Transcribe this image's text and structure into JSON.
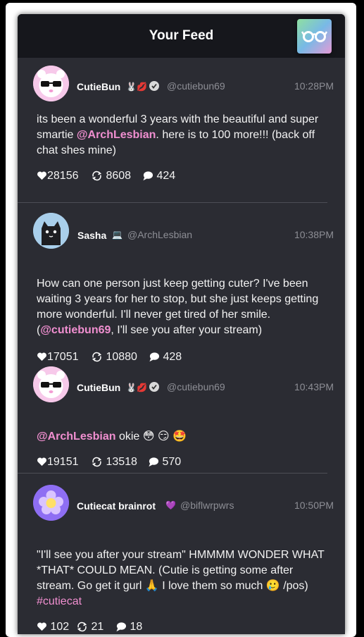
{
  "header": {
    "title": "Your Feed",
    "menu_icon": "glasses-icon"
  },
  "posts": [
    {
      "name": "CutieBun",
      "badges": "🐰💋",
      "handle": "@cutiebun69",
      "time": "10:28PM",
      "text_before": "its been a wonderful 3 years with the beautiful and super smartie ",
      "mention": "@ArchLesbian",
      "text_after": ". here is to 100 more!!! (back off chat shes mine)",
      "likes": "28156",
      "reposts": "8608",
      "replies": "424",
      "avatar": "panda-sunglasses-avatar"
    },
    {
      "name": "Sasha",
      "badges": "💻",
      "handle": "@ArchLesbian",
      "time": "10:38PM",
      "text_before": "How can one person just keep getting cuter? I've been waiting 3 years for her to stop, but she just keeps getting more wonderful. I'll never get tired of her smile. (",
      "mention": "@cutiebun69",
      "text_after": ", I'll see you after your stream)",
      "likes": "17051",
      "reposts": "10880",
      "replies": "428",
      "avatar": "black-cat-avatar"
    },
    {
      "name": "CutieBun",
      "badges": "🐰💋",
      "handle": "@cutiebun69",
      "time": "10:43PM",
      "mention": "@ArchLesbian",
      "text_after": " okie 😳 😏 🤩",
      "likes": "19151",
      "reposts": "13518",
      "replies": "570",
      "avatar": "panda-sunglasses-avatar"
    },
    {
      "name": "Cutiecat brainrot",
      "badges": "💜",
      "handle": "@biflwrpwrs",
      "time": "10:50PM",
      "text_before": "\"I'll see you after your stream\" HMMMM WONDER WHAT *THAT* COULD MEAN. (Cutie is getting some after stream. Go get it gurl 🙏 I love them so much 🥲 /pos) ",
      "hashtag": "#cutiecat",
      "likes": "102",
      "reposts": "21",
      "replies": "18",
      "avatar": "purple-flower-avatar"
    }
  ],
  "colors": {
    "accent": "#f08fd0",
    "panel": "#2b2c33",
    "header": "#16171c",
    "muted": "#8d8e95"
  }
}
